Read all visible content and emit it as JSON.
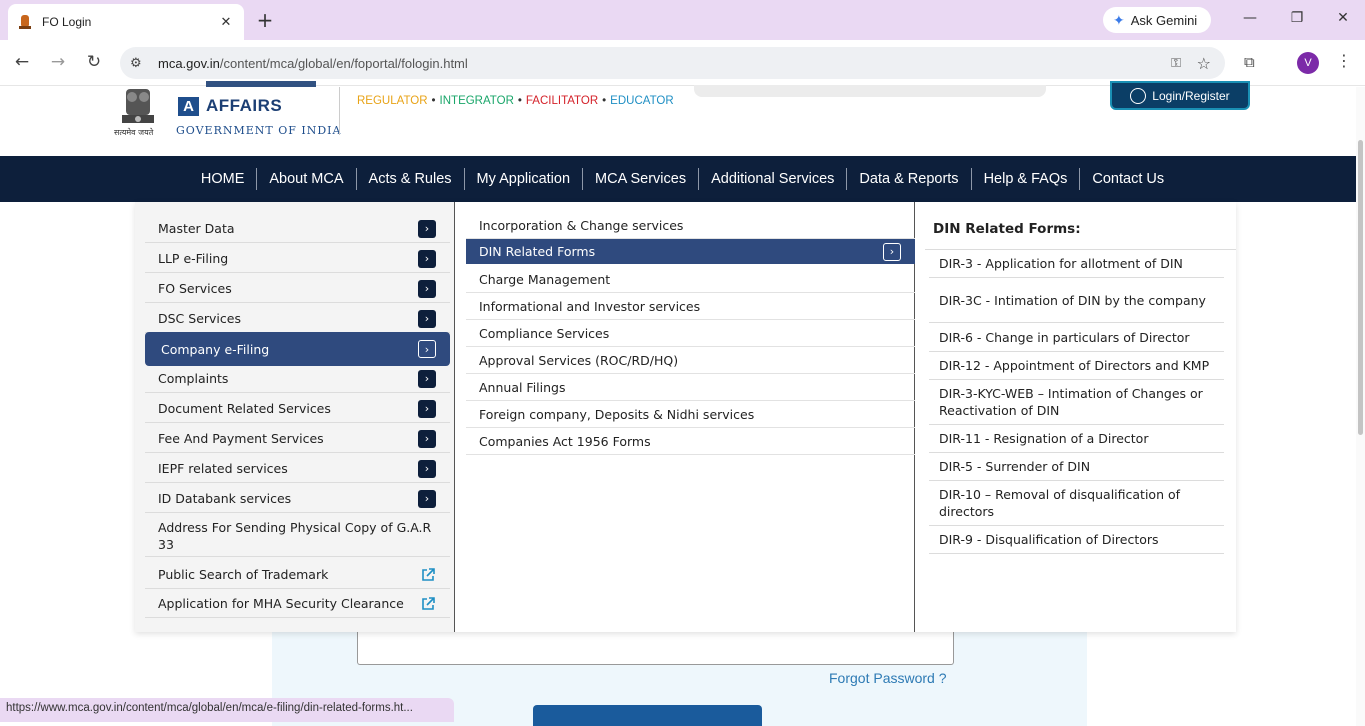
{
  "browser": {
    "tab_title": "FO Login",
    "tab_close": "✕",
    "new_tab": "+",
    "ask_gemini": "Ask Gemini",
    "url_domain": "mca.gov.in",
    "url_path": "/content/mca/global/en/foportal/fologin.html",
    "avatar_letter": "V",
    "status_url": "https://www.mca.gov.in/content/mca/global/en/mca/e-filing/din-related-forms.ht..."
  },
  "header": {
    "brand_letter": "A",
    "brand_word": "AFFAIRS",
    "emblem_caption": "सत्यमेव जयते",
    "government": "GOVERNMENT OF INDIA",
    "tagline": [
      {
        "text": "REGULATOR",
        "color": "#e8a317"
      },
      {
        "text": "INTEGRATOR",
        "color": "#1aa66a"
      },
      {
        "text": "FACILITATOR",
        "color": "#d4222a"
      },
      {
        "text": "EDUCATOR",
        "color": "#1f8fc4"
      }
    ],
    "login_label": "Login/Register"
  },
  "nav": {
    "items": [
      "HOME",
      "About MCA",
      "Acts & Rules",
      "My Application",
      "MCA Services",
      "Additional Services",
      "Data & Reports",
      "Help & FAQs",
      "Contact Us"
    ]
  },
  "menu": {
    "level1": [
      {
        "label": "Master Data",
        "type": "arrow"
      },
      {
        "label": "LLP e-Filing",
        "type": "arrow"
      },
      {
        "label": "FO Services",
        "type": "arrow"
      },
      {
        "label": "DSC Services",
        "type": "arrow"
      },
      {
        "label": "Company e-Filing",
        "type": "arrow",
        "active": true
      },
      {
        "label": "Complaints",
        "type": "arrow"
      },
      {
        "label": "Document Related Services",
        "type": "arrow"
      },
      {
        "label": "Fee And Payment Services",
        "type": "arrow"
      },
      {
        "label": "IEPF related services",
        "type": "arrow"
      },
      {
        "label": "ID Databank services",
        "type": "arrow"
      },
      {
        "label": "Address For Sending Physical Copy of G.A.R 33",
        "type": "none"
      },
      {
        "label": "Public Search of Trademark",
        "type": "external"
      },
      {
        "label": "Application for MHA Security Clearance",
        "type": "external"
      }
    ],
    "level2": [
      {
        "label": "Incorporation & Change services"
      },
      {
        "label": "DIN Related Forms",
        "active": true
      },
      {
        "label": "Charge Management"
      },
      {
        "label": "Informational and Investor services"
      },
      {
        "label": "Compliance Services"
      },
      {
        "label": "Approval Services (ROC/RD/HQ)"
      },
      {
        "label": "Annual Filings"
      },
      {
        "label": "Foreign company, Deposits & Nidhi services"
      },
      {
        "label": "Companies Act 1956 Forms"
      }
    ],
    "level3_heading": "DIN Related Forms:",
    "level3": [
      "DIR-3 - Application for allotment of DIN",
      "DIR-3C - Intimation of DIN by the company",
      "DIR-6 - Change in particulars of Director",
      "DIR-12 - Appointment of Directors and KMP",
      "DIR-3-KYC-WEB – Intimation of Changes or Reactivation of DIN",
      "DIR-11 - Resignation of a Director",
      "DIR-5 - Surrender of DIN",
      "DIR-10 – Removal of disqualification of directors",
      "DIR-9 - Disqualification of Directors"
    ]
  },
  "form": {
    "forgot_password": "Forgot Password ?"
  },
  "icons": {
    "arrow": "›",
    "back": "←",
    "forward": "→",
    "reload": "↻",
    "minimize": "—",
    "restore": "❐",
    "close": "✕",
    "star": "☆",
    "key": "⚿",
    "kebab": "⋮"
  }
}
